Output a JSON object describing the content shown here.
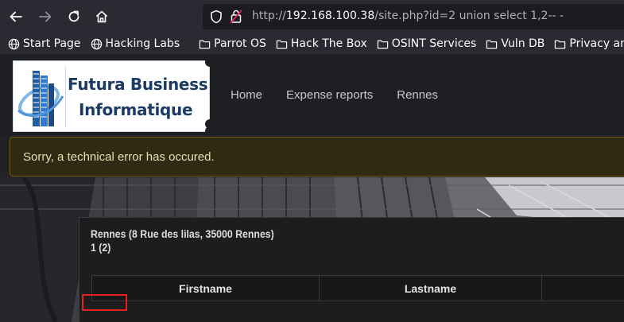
{
  "browser": {
    "url_prefix": "http://",
    "url_host": "192.168.100.38",
    "url_rest": "/site.php?id=2 union select 1,2-- -",
    "bookmarks": [
      {
        "label": "Start Page",
        "icon": "globe-icon"
      },
      {
        "label": "Hacking Labs",
        "icon": "globe-icon"
      },
      {
        "label": "Parrot OS",
        "icon": "folder-icon"
      },
      {
        "label": "Hack The Box",
        "icon": "folder-icon"
      },
      {
        "label": "OSINT Services",
        "icon": "folder-icon"
      },
      {
        "label": "Vuln DB",
        "icon": "folder-icon"
      },
      {
        "label": "Privacy and S",
        "icon": "folder-icon"
      }
    ]
  },
  "site": {
    "logo_line1": "Futura Business",
    "logo_line2": "Informatique",
    "menu": [
      "Home",
      "Expense reports",
      "Rennes"
    ],
    "alert": "Sorry, a technical error has occured.",
    "card_title": "Rennes (8 Rue des lilas, 35000 Rennes)",
    "card_sub": "1 (2)",
    "table_headers": [
      "Firstname",
      "Lastname",
      ""
    ]
  },
  "colors": {
    "highlight": "#e52020",
    "alert_bg": "#302a12",
    "logo_text": "#1b3a64"
  }
}
